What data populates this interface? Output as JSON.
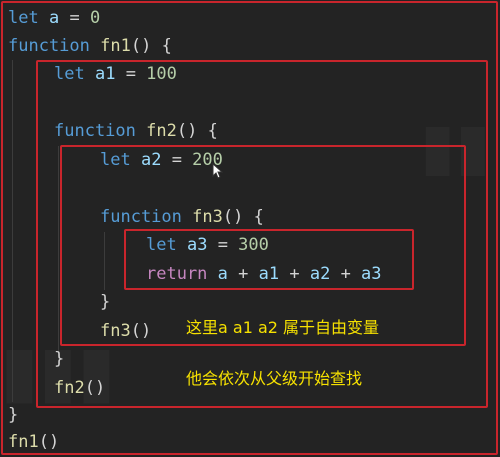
{
  "code": {
    "l1": {
      "kw": "let",
      "var": "a",
      "op": " = ",
      "num": "0"
    },
    "l2": {
      "kw": "function",
      "fn": "fn1",
      "rest": "() {"
    },
    "l3": {
      "kw": "let",
      "var": "a1",
      "op": " = ",
      "num": "100"
    },
    "l4": {
      "kw": "function",
      "fn": "fn2",
      "rest": "() {"
    },
    "l5": {
      "kw": "let",
      "var": "a2",
      "op": " = ",
      "num": "200"
    },
    "l6": {
      "kw": "function",
      "fn": "fn3",
      "rest": "() {"
    },
    "l7": {
      "kw": "let",
      "var": "a3",
      "op": " = ",
      "num": "300"
    },
    "l8": {
      "ctl": "return",
      "v1": "a",
      "v2": "a1",
      "v3": "a2",
      "v4": "a3",
      "plus": " + "
    },
    "l9": {
      "rest": "}"
    },
    "l10": {
      "fn": "fn3",
      "rest": "()"
    },
    "l11": {
      "rest": "}"
    },
    "l12": {
      "fn": "fn2",
      "rest": "()"
    },
    "l13": {
      "rest": "}"
    },
    "l14": {
      "fn": "fn1",
      "rest": "()"
    }
  },
  "notes": {
    "free_vars": "这里a a1 a2 属于自由变量",
    "lookup": "他会依次从父级开始查找"
  },
  "colors": {
    "highlight_box": "#c9252c",
    "note_text": "#f6e100"
  }
}
